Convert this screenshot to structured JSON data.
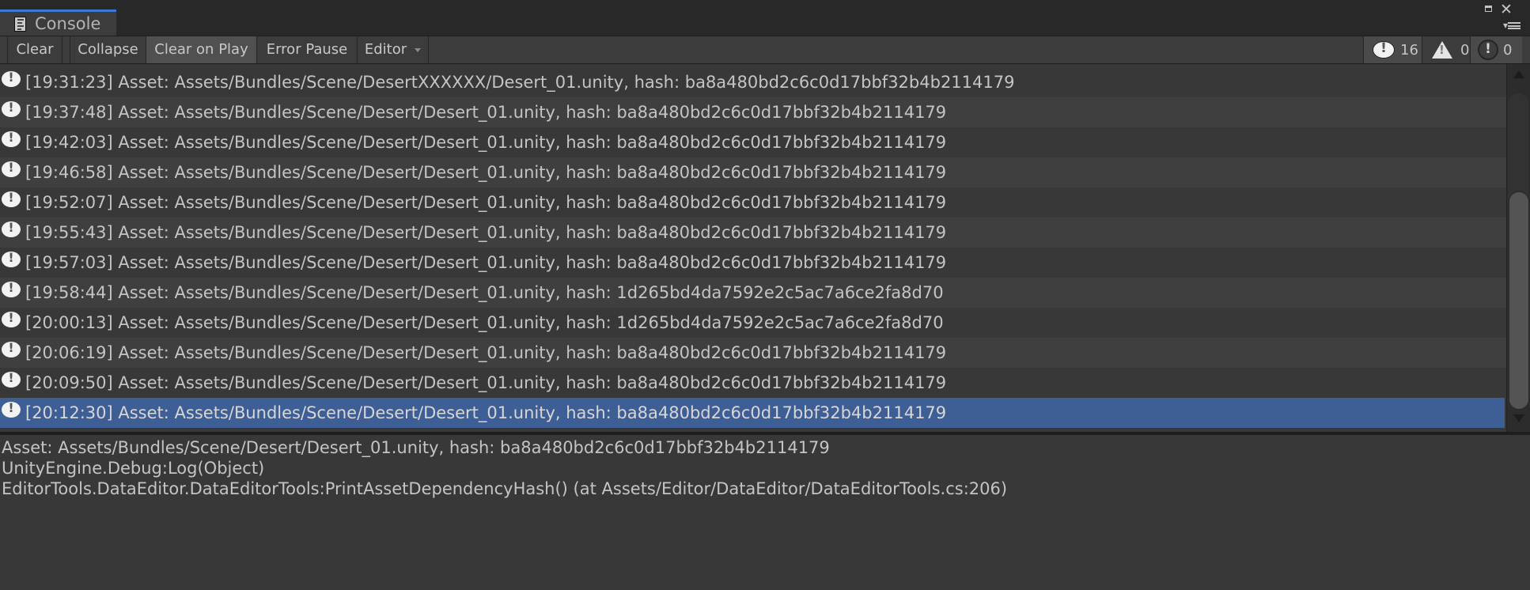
{
  "window": {
    "tab_label": "Console",
    "tab_icon": "console-doc-icon",
    "controls": [
      "maximize-icon",
      "close-icon",
      "window-menu-icon"
    ]
  },
  "toolbar": {
    "clear": "Clear",
    "collapse": "Collapse",
    "clear_on_play": "Clear on Play",
    "clear_on_play_active": true,
    "error_pause": "Error Pause",
    "editor": "Editor",
    "counters": {
      "info": {
        "icon": "info-icon",
        "count": "16",
        "active": true
      },
      "warning": {
        "icon": "warning-icon",
        "count": "0",
        "active": false
      },
      "error": {
        "icon": "error-icon",
        "count": "0",
        "active": true
      }
    }
  },
  "log": {
    "selected_index": 11,
    "entries": [
      {
        "icon": "info-icon",
        "text": "[19:31:23] Asset: Assets/Bundles/Scene/DesertXXXXXX/Desert_01.unity, hash: ba8a480bd2c6c0d17bbf32b4b2114179"
      },
      {
        "icon": "info-icon",
        "text": "[19:37:48] Asset: Assets/Bundles/Scene/Desert/Desert_01.unity, hash: ba8a480bd2c6c0d17bbf32b4b2114179"
      },
      {
        "icon": "info-icon",
        "text": "[19:42:03] Asset: Assets/Bundles/Scene/Desert/Desert_01.unity, hash: ba8a480bd2c6c0d17bbf32b4b2114179"
      },
      {
        "icon": "info-icon",
        "text": "[19:46:58] Asset: Assets/Bundles/Scene/Desert/Desert_01.unity, hash: ba8a480bd2c6c0d17bbf32b4b2114179"
      },
      {
        "icon": "info-icon",
        "text": "[19:52:07] Asset: Assets/Bundles/Scene/Desert/Desert_01.unity, hash: ba8a480bd2c6c0d17bbf32b4b2114179"
      },
      {
        "icon": "info-icon",
        "text": "[19:55:43] Asset: Assets/Bundles/Scene/Desert/Desert_01.unity, hash: ba8a480bd2c6c0d17bbf32b4b2114179"
      },
      {
        "icon": "info-icon",
        "text": "[19:57:03] Asset: Assets/Bundles/Scene/Desert/Desert_01.unity, hash: ba8a480bd2c6c0d17bbf32b4b2114179"
      },
      {
        "icon": "info-icon",
        "text": "[19:58:44] Asset: Assets/Bundles/Scene/Desert/Desert_01.unity, hash: 1d265bd4da7592e2c5ac7a6ce2fa8d70"
      },
      {
        "icon": "info-icon",
        "text": "[20:00:13] Asset: Assets/Bundles/Scene/Desert/Desert_01.unity, hash: 1d265bd4da7592e2c5ac7a6ce2fa8d70"
      },
      {
        "icon": "info-icon",
        "text": "[20:06:19] Asset: Assets/Bundles/Scene/Desert/Desert_01.unity, hash: ba8a480bd2c6c0d17bbf32b4b2114179"
      },
      {
        "icon": "info-icon",
        "text": "[20:09:50] Asset: Assets/Bundles/Scene/Desert/Desert_01.unity, hash: ba8a480bd2c6c0d17bbf32b4b2114179"
      },
      {
        "icon": "info-icon",
        "text": "[20:12:30] Asset: Assets/Bundles/Scene/Desert/Desert_01.unity, hash: ba8a480bd2c6c0d17bbf32b4b2114179"
      }
    ],
    "scroll": {
      "thumb_start_fraction": 0.31,
      "thumb_end_fraction": 1.0
    }
  },
  "detail": {
    "lines": [
      "Asset: Assets/Bundles/Scene/Desert/Desert_01.unity, hash: ba8a480bd2c6c0d17bbf32b4b2114179",
      "UnityEngine.Debug:Log(Object)",
      "EditorTools.DataEditor.DataEditorTools:PrintAssetDependencyHash() (at Assets/Editor/DataEditor/DataEditorTools.cs:206)"
    ]
  },
  "colors": {
    "selection": "#3e5f96",
    "tab_accent": "#3a79d4",
    "background": "#383838"
  }
}
